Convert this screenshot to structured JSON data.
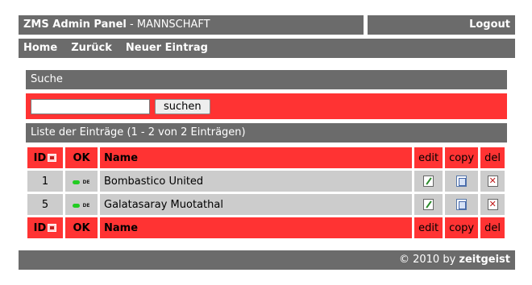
{
  "header": {
    "app_title": "ZMS Admin Panel",
    "separator": " - ",
    "section": "MANNSCHAFT",
    "logout_label": "Logout"
  },
  "nav": {
    "items": [
      {
        "label": "Home"
      },
      {
        "label": "Zurück"
      },
      {
        "label": "Neuer Eintrag"
      }
    ]
  },
  "search": {
    "heading": "Suche",
    "input_value": "",
    "input_placeholder": "",
    "button_label": "suchen"
  },
  "list": {
    "heading": "Liste der Einträge (1 - 2 von 2 Einträgen)",
    "columns": {
      "id": "ID",
      "ok": "OK",
      "name": "Name",
      "edit": "edit",
      "copy": "copy",
      "del": "del"
    },
    "rows": [
      {
        "id": "1",
        "status": "active",
        "lang": "DE",
        "name": "Bombastico United"
      },
      {
        "id": "5",
        "status": "active",
        "lang": "DE",
        "name": "Galatasaray Muotathal"
      }
    ]
  },
  "footer": {
    "copyright": "© 2010 by ",
    "brand": "zeitgeist"
  },
  "colors": {
    "bar_gray": "#6b6b6b",
    "accent_red": "#ff3333",
    "row_gray": "#cccccc",
    "status_green": "#22cc22"
  },
  "icons": {
    "sort": "sort-icon",
    "status": "status-dot-icon",
    "edit": "edit-icon",
    "copy": "copy-icon",
    "delete": "delete-icon"
  }
}
